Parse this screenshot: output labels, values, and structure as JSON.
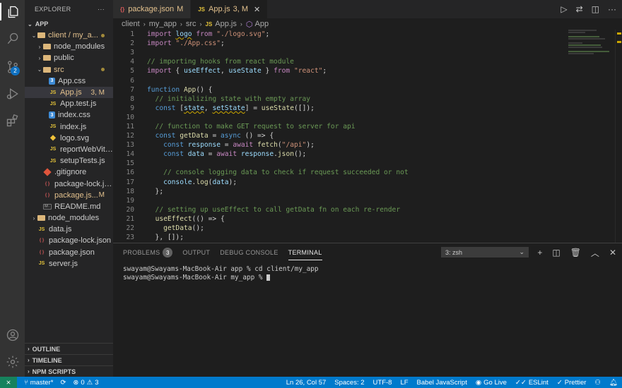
{
  "colors": {
    "accent": "#007acc",
    "modified": "#e2c08d",
    "remote": "#16825d"
  },
  "activity": {
    "scm_badge": "2"
  },
  "sidebar": {
    "title": "EXPLORER",
    "more": "···",
    "root": "APP",
    "items": [
      {
        "label": "client / my_a...",
        "depth": 0,
        "type": "folder-open",
        "status": "dot"
      },
      {
        "label": "node_modules",
        "depth": 1,
        "type": "folder",
        "status": ""
      },
      {
        "label": "public",
        "depth": 1,
        "type": "folder",
        "status": ""
      },
      {
        "label": "src",
        "depth": 1,
        "type": "folder-open",
        "status": "dot"
      },
      {
        "label": "App.css",
        "depth": 2,
        "type": "css",
        "status": ""
      },
      {
        "label": "App.js",
        "depth": 2,
        "type": "js",
        "status": "3, M",
        "selected": true
      },
      {
        "label": "App.test.js",
        "depth": 2,
        "type": "js",
        "status": ""
      },
      {
        "label": "index.css",
        "depth": 2,
        "type": "css",
        "status": ""
      },
      {
        "label": "index.js",
        "depth": 2,
        "type": "js",
        "status": ""
      },
      {
        "label": "logo.svg",
        "depth": 2,
        "type": "svg",
        "status": ""
      },
      {
        "label": "reportWebVita...",
        "depth": 2,
        "type": "js",
        "status": ""
      },
      {
        "label": "setupTests.js",
        "depth": 2,
        "type": "js",
        "status": ""
      },
      {
        "label": ".gitignore",
        "depth": 1,
        "type": "git",
        "status": ""
      },
      {
        "label": "package-lock.js...",
        "depth": 1,
        "type": "json",
        "status": ""
      },
      {
        "label": "package.js...",
        "depth": 1,
        "type": "json",
        "status": "M"
      },
      {
        "label": "README.md",
        "depth": 1,
        "type": "md",
        "status": ""
      },
      {
        "label": "node_modules",
        "depth": 0,
        "type": "folder",
        "status": ""
      },
      {
        "label": "data.js",
        "depth": 0,
        "type": "js",
        "status": ""
      },
      {
        "label": "package-lock.json",
        "depth": 0,
        "type": "json",
        "status": ""
      },
      {
        "label": "package.json",
        "depth": 0,
        "type": "json",
        "status": ""
      },
      {
        "label": "server.js",
        "depth": 0,
        "type": "js",
        "status": ""
      }
    ],
    "outline": "OUTLINE",
    "timeline": "TIMELINE",
    "npm": "NPM SCRIPTS"
  },
  "tabs": [
    {
      "label": "package.json",
      "status": "M",
      "icon": "{}",
      "active": false
    },
    {
      "label": "App.js",
      "status": "3, M",
      "icon": "JS",
      "active": true
    }
  ],
  "breadcrumb": [
    "client",
    "my_app",
    "src",
    "App.js",
    "App"
  ],
  "code": [
    "import logo from \"./logo.svg\";",
    "import \"./App.css\";",
    "",
    "// importing hooks from react module",
    "import { useEffect, useState } from \"react\";",
    "",
    "function App() {",
    "  // initializing state with empty array",
    "  const [state, setState] = useState([]);",
    "",
    "  // function to make GET request to server for api",
    "  const getData = async () => {",
    "    const response = await fetch(\"/api\");",
    "    const data = await response.json();",
    "",
    "    // console logging data to check if request succeeded or not",
    "    console.log(data);",
    "  };",
    "",
    "  // setting up useEffect to call getData fn on each re-render",
    "  useEffect(() => {",
    "    getData();",
    "  }, []);"
  ],
  "panel": {
    "tabs": [
      "PROBLEMS",
      "OUTPUT",
      "DEBUG CONSOLE",
      "TERMINAL"
    ],
    "problems_count": "3",
    "terminal_select": "3: zsh",
    "terminal_lines": [
      "swayam@Swayams-MacBook-Air app % cd client/my_app",
      "swayam@Swayams-MacBook-Air my_app % "
    ]
  },
  "status": {
    "branch": "master*",
    "errors": "0",
    "warnings": "3",
    "position": "Ln 26, Col 57",
    "spaces": "Spaces: 2",
    "encoding": "UTF-8",
    "eol": "LF",
    "language": "Babel JavaScript",
    "golive": "Go Live",
    "eslint": "ESLint",
    "prettier": "Prettier"
  }
}
